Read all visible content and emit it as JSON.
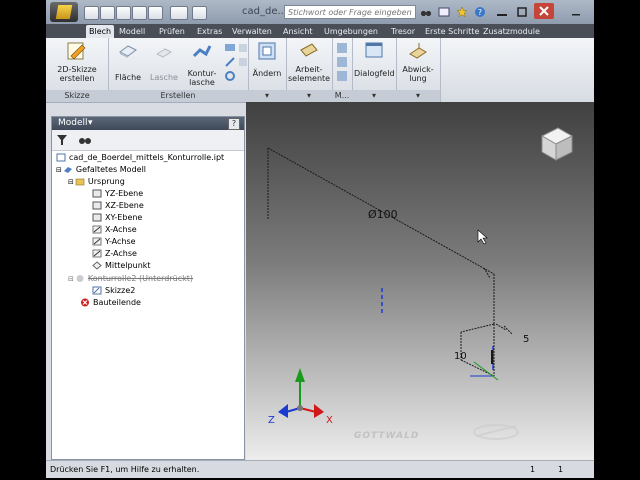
{
  "title_bar": {
    "document_title": "cad_de...",
    "search_placeholder": "Stichwort oder Frage eingeben"
  },
  "tabs": [
    {
      "label": "Blech",
      "active": true
    },
    {
      "label": "Modell"
    },
    {
      "label": "Prüfen"
    },
    {
      "label": "Extras"
    },
    {
      "label": "Verwalten"
    },
    {
      "label": "Ansicht"
    },
    {
      "label": "Umgebungen"
    },
    {
      "label": "Tresor"
    },
    {
      "label": "Erste Schritte"
    },
    {
      "label": "Zusatzmodule"
    }
  ],
  "ribbon": {
    "skizze": {
      "title": "Skizze",
      "btn_line1": "2D-Skizze",
      "btn_line2": "erstellen"
    },
    "erstellen": {
      "title": "Erstellen",
      "flaeche": "Fläche",
      "lasche": "Lasche",
      "kontur_line1": "Kontur-",
      "kontur_line2": "lasche"
    },
    "aendern": "Ändern",
    "arbeit_line1": "Arbeit-",
    "arbeit_line2": "selemente",
    "m_label": "M...",
    "dialogfeld": "Dialogfeld",
    "abwicklung_line1": "Abwick-",
    "abwicklung_line2": "lung"
  },
  "browser": {
    "header": "Modell",
    "help": "?",
    "items": [
      "cad_de_Boerdel_mittels_Konturrolle.ipt",
      "Gefaltetes Modell",
      "Ursprung",
      "YZ-Ebene",
      "XZ-Ebene",
      "XY-Ebene",
      "X-Achse",
      "Y-Achse",
      "Z-Achse",
      "Mittelpunkt",
      "Konturrolle2 (Unterdrückt)",
      "Skizze2",
      "Bauteilende"
    ]
  },
  "viewport": {
    "dim_diameter": "Ø100",
    "dim_5": "5",
    "dim_10": "10",
    "axis_x": "X",
    "axis_z": "Z",
    "watermark": "GOTTWALD"
  },
  "status": {
    "hint": "Drücken Sie F1, um Hilfe zu erhalten.",
    "val1": "1",
    "val2": "1"
  },
  "colors": {
    "accent_x": "#d01818",
    "accent_y": "#1a9a1a",
    "accent_z": "#1a3ad0"
  }
}
